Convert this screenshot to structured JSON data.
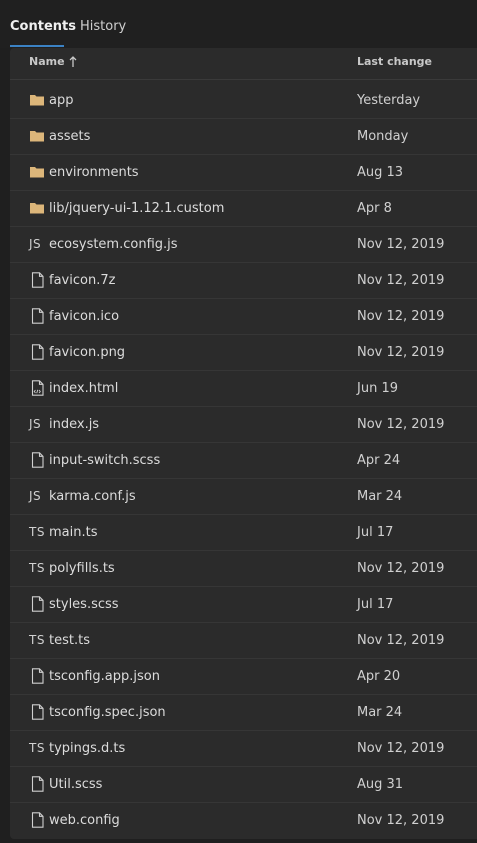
{
  "tabs": [
    {
      "label": "Contents",
      "active": true
    },
    {
      "label": "History",
      "active": false
    }
  ],
  "table": {
    "columns": {
      "name": "Name",
      "last_change": "Last change"
    },
    "sort": {
      "column": "name",
      "direction": "ascending",
      "icon": "sort-up-arrow-icon"
    },
    "rows": [
      {
        "icon": "folder-icon",
        "name": "app",
        "last_change": "Yesterday"
      },
      {
        "icon": "folder-icon",
        "name": "assets",
        "last_change": "Monday"
      },
      {
        "icon": "folder-icon",
        "name": "environments",
        "last_change": "Aug 13"
      },
      {
        "icon": "folder-icon",
        "name": "lib/jquery-ui-1.12.1.custom",
        "last_change": "Apr 8"
      },
      {
        "icon": "js-file-icon",
        "icon_text": "JS",
        "name": "ecosystem.config.js",
        "last_change": "Nov 12, 2019"
      },
      {
        "icon": "file-icon",
        "name": "favicon.7z",
        "last_change": "Nov 12, 2019"
      },
      {
        "icon": "file-icon",
        "name": "favicon.ico",
        "last_change": "Nov 12, 2019"
      },
      {
        "icon": "file-icon",
        "name": "favicon.png",
        "last_change": "Nov 12, 2019"
      },
      {
        "icon": "html-file-icon",
        "name": "index.html",
        "last_change": "Jun 19"
      },
      {
        "icon": "js-file-icon",
        "icon_text": "JS",
        "name": "index.js",
        "last_change": "Nov 12, 2019"
      },
      {
        "icon": "file-icon",
        "name": "input-switch.scss",
        "last_change": "Apr 24"
      },
      {
        "icon": "js-file-icon",
        "icon_text": "JS",
        "name": "karma.conf.js",
        "last_change": "Mar 24"
      },
      {
        "icon": "ts-file-icon",
        "icon_text": "TS",
        "name": "main.ts",
        "last_change": "Jul 17"
      },
      {
        "icon": "ts-file-icon",
        "icon_text": "TS",
        "name": "polyfills.ts",
        "last_change": "Nov 12, 2019"
      },
      {
        "icon": "file-icon",
        "name": "styles.scss",
        "last_change": "Jul 17"
      },
      {
        "icon": "ts-file-icon",
        "icon_text": "TS",
        "name": "test.ts",
        "last_change": "Nov 12, 2019"
      },
      {
        "icon": "file-icon",
        "name": "tsconfig.app.json",
        "last_change": "Apr 20"
      },
      {
        "icon": "file-icon",
        "name": "tsconfig.spec.json",
        "last_change": "Mar 24"
      },
      {
        "icon": "ts-file-icon",
        "icon_text": "TS",
        "name": "typings.d.ts",
        "last_change": "Nov 12, 2019"
      },
      {
        "icon": "file-icon",
        "name": "Util.scss",
        "last_change": "Aug 31"
      },
      {
        "icon": "file-icon",
        "name": "web.config",
        "last_change": "Nov 12, 2019"
      }
    ]
  },
  "colors": {
    "background": "#1f1f1f",
    "panel": "#2b2b2b",
    "accent": "#3b82c4",
    "folder": "#dcb67a",
    "text": "#dcdcdc"
  }
}
